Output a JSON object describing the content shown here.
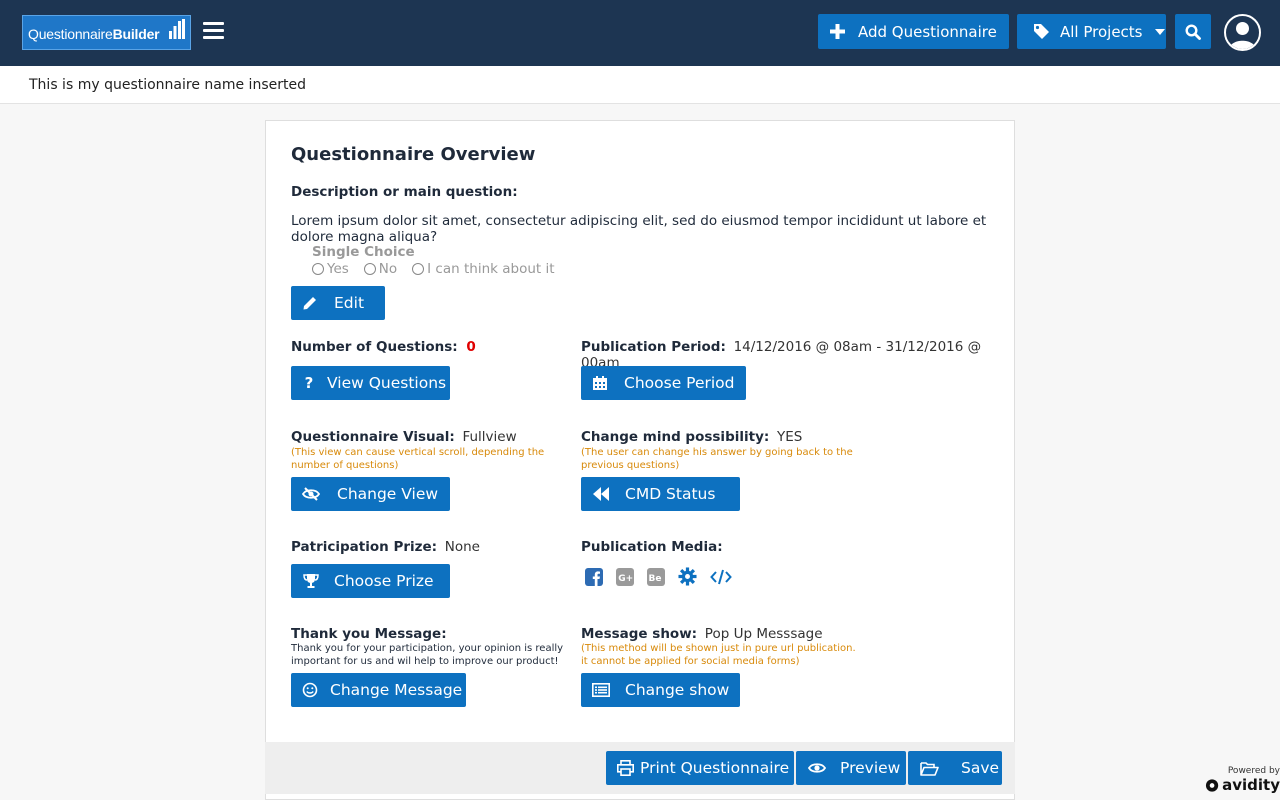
{
  "brand": {
    "logo_part1": "Questionnaire",
    "logo_part2": "Builder"
  },
  "header": {
    "add_label": "Add Questionnaire",
    "projects_label": "All Projects"
  },
  "questionnaire_name": "This is my questionnaire name inserted",
  "overview": {
    "title": "Questionnaire Overview",
    "description_label": "Description or main question:",
    "description_text": "Lorem ipsum dolor sit amet, consectetur adipiscing elit, sed do eiusmod tempor incididunt ut labore et dolore magna aliqua?",
    "question_type": "Single Choice",
    "options": [
      "Yes",
      "No",
      "I can think about it"
    ],
    "edit_label": "Edit"
  },
  "fields": {
    "num_questions_label": "Number of Questions:",
    "num_questions_value": "0",
    "view_questions_label": "View Questions",
    "publication_period_label": "Publication Period:",
    "publication_period_value": "14/12/2016 @ 08am - 31/12/2016 @ 00am",
    "choose_period_label": "Choose Period",
    "visual_label": "Questionnaire Visual:",
    "visual_value": "Fullview",
    "visual_note_1": "(This view can cause vertical scroll, depending  the",
    "visual_note_2": "number of questions)",
    "change_view_label": "Change View",
    "cmd_label": "Change mind possibility:",
    "cmd_value": "YES",
    "cmd_note_1": "(The user can change his answer by going back to the",
    "cmd_note_2": "previous questions)",
    "cmd_status_label": "CMD Status",
    "prize_label": "Patricipation Prize:",
    "prize_value": "None",
    "choose_prize_label": "Choose Prize",
    "media_label": "Publication Media:",
    "thank_label": "Thank you Message:",
    "thank_text_1": "Thank you for your participation, your opinion is really",
    "thank_text_2": "important for us and wil help to improve our product!",
    "change_message_label": "Change Message",
    "message_show_label": "Message show:",
    "message_show_value": "Pop Up Messsage",
    "message_show_note_1": "(This method will be shown just in pure url publication.",
    "message_show_note_2": "it cannot be applied for social media forms)",
    "change_show_label": "Change show"
  },
  "media_icons": [
    "facebook-icon",
    "google-plus-icon",
    "behance-icon",
    "gear-icon",
    "code-icon"
  ],
  "footer": {
    "print_label": "Print Questionnaire",
    "preview_label": "Preview",
    "save_label": "Save"
  },
  "powered": {
    "line1": "Powered by",
    "brand": "avidity"
  },
  "colors": {
    "topbar": "#1d3552",
    "primary": "#0d71c0",
    "note": "#d88a0b",
    "zero": "#e00000"
  }
}
